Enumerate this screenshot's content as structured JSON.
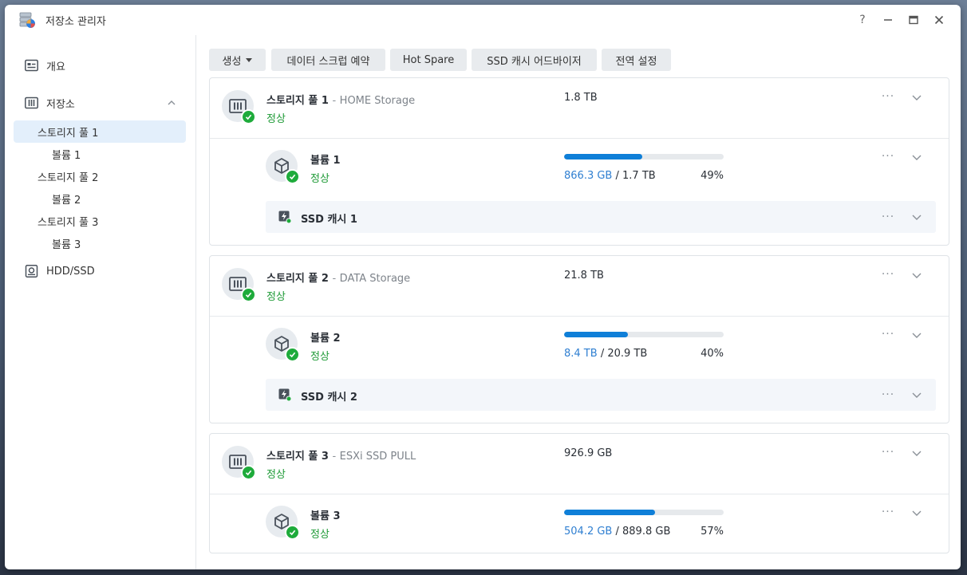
{
  "app": {
    "title": "저장소 관리자"
  },
  "window_controls": {
    "help": "?",
    "minimize": "–",
    "maximize": "□",
    "close": "✕"
  },
  "sidebar": {
    "overview": "개요",
    "storage": "저장소",
    "pools": [
      {
        "label": "스토리지 풀 1",
        "volume": "볼륨 1"
      },
      {
        "label": "스토리지 풀 2",
        "volume": "볼륨 2"
      },
      {
        "label": "스토리지 풀 3",
        "volume": "볼륨 3"
      }
    ],
    "hdd": "HDD/SSD"
  },
  "toolbar": {
    "create": "생성",
    "scrub": "데이터 스크럽 예약",
    "hot_spare": "Hot Spare",
    "ssd_advisor": "SSD 캐시 어드바이저",
    "global_settings": "전역 설정"
  },
  "pools": [
    {
      "name": "스토리지 풀 1",
      "separator": "-",
      "desc": "HOME Storage",
      "status": "정상",
      "size": "1.8 TB",
      "volume": {
        "name": "볼륨 1",
        "status": "정상",
        "used": "866.3 GB",
        "slash": "/",
        "total": "1.7 TB",
        "percent": "49%",
        "fraction": 0.49
      },
      "cache": "SSD 캐시 1"
    },
    {
      "name": "스토리지 풀 2",
      "separator": "-",
      "desc": "DATA Storage",
      "status": "정상",
      "size": "21.8 TB",
      "volume": {
        "name": "볼륨 2",
        "status": "정상",
        "used": "8.4 TB",
        "slash": "/",
        "total": "20.9 TB",
        "percent": "40%",
        "fraction": 0.4
      },
      "cache": "SSD 캐시 2"
    },
    {
      "name": "스토리지 풀 3",
      "separator": "-",
      "desc": "ESXi SSD PULL",
      "status": "정상",
      "size": "926.9 GB",
      "volume": {
        "name": "볼륨 3",
        "status": "정상",
        "used": "504.2 GB",
        "slash": "/",
        "total": "889.8 GB",
        "percent": "57%",
        "fraction": 0.57
      }
    }
  ],
  "more_glyph": "···",
  "colors": {
    "accent": "#0f7fd8",
    "status_ok": "#1e9a36",
    "used_text": "#2f7fd1"
  }
}
